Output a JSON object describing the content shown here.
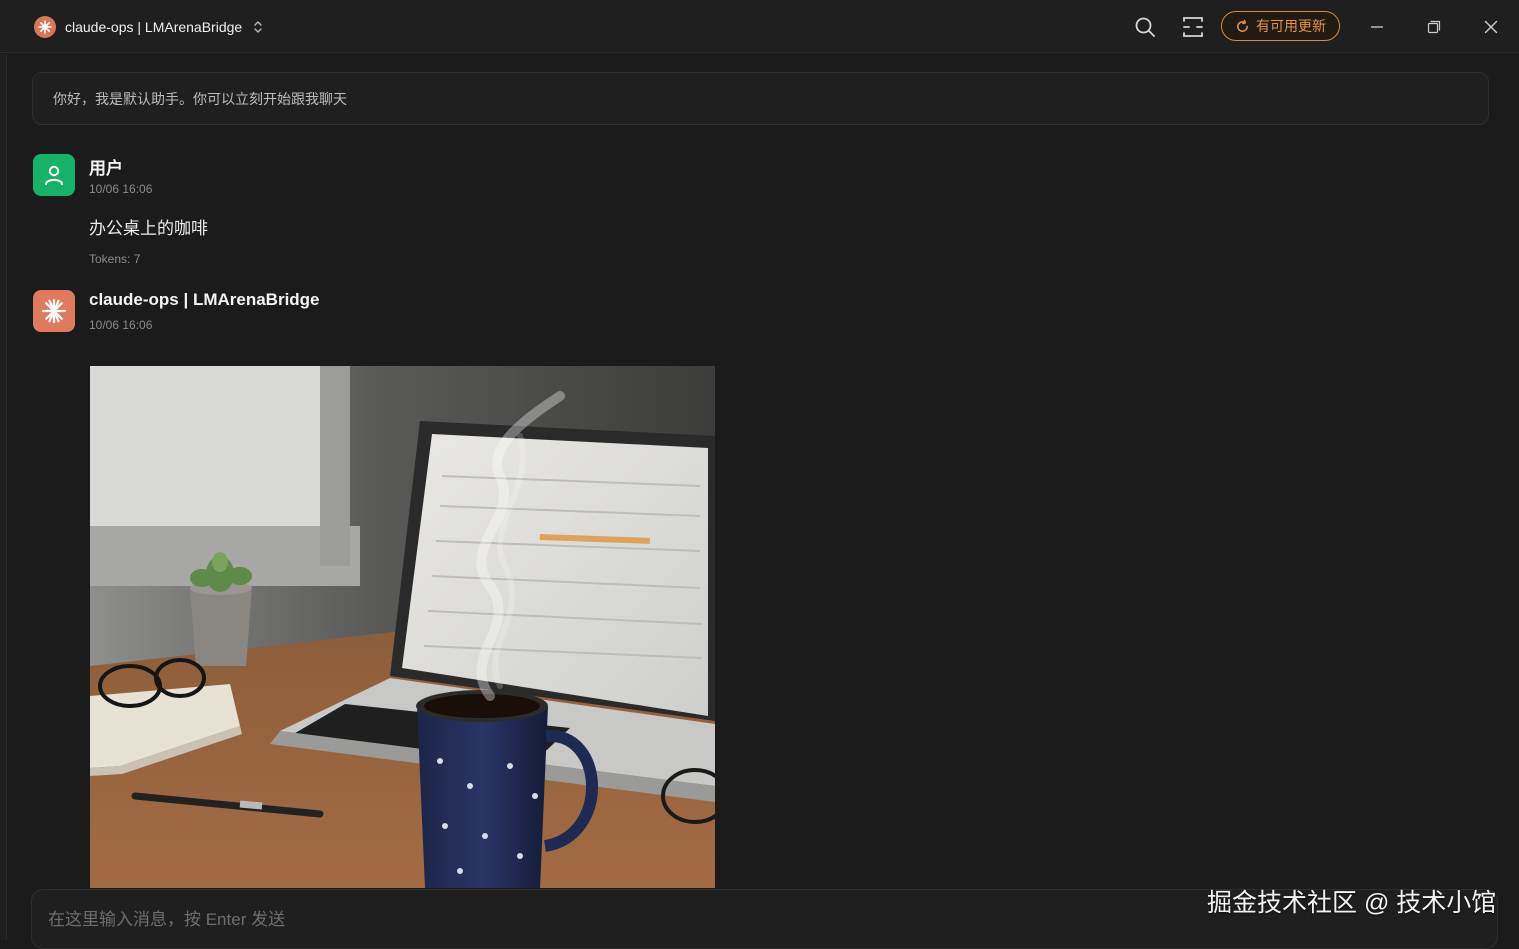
{
  "titlebar": {
    "model_name": "claude-ops | LMArenaBridge",
    "update_label": "有可用更新",
    "icons": [
      "claude-logo-icon",
      "chevron-updown-icon",
      "search-icon",
      "layout-icon",
      "refresh-icon",
      "minimize-icon",
      "restore-icon",
      "close-icon"
    ]
  },
  "greeting": "你好，我是默认助手。你可以立刻开始跟我聊天",
  "messages": [
    {
      "role": "user",
      "sender": "用户",
      "time": "10/06 16:06",
      "content": "办公桌上的咖啡",
      "tokens": "Tokens: 7"
    },
    {
      "role": "assistant",
      "sender": "claude-ops | LMArenaBridge",
      "time": "10/06 16:06"
    }
  ],
  "input": {
    "placeholder": "在这里输入消息，按 Enter 发送"
  },
  "watermark": "掘金技术社区 @ 技术小馆",
  "colors": {
    "background": "#1b1b1b",
    "accent_orange": "#e5963f",
    "user_avatar": "#17b26a",
    "bot_avatar": "#e07a5f"
  }
}
